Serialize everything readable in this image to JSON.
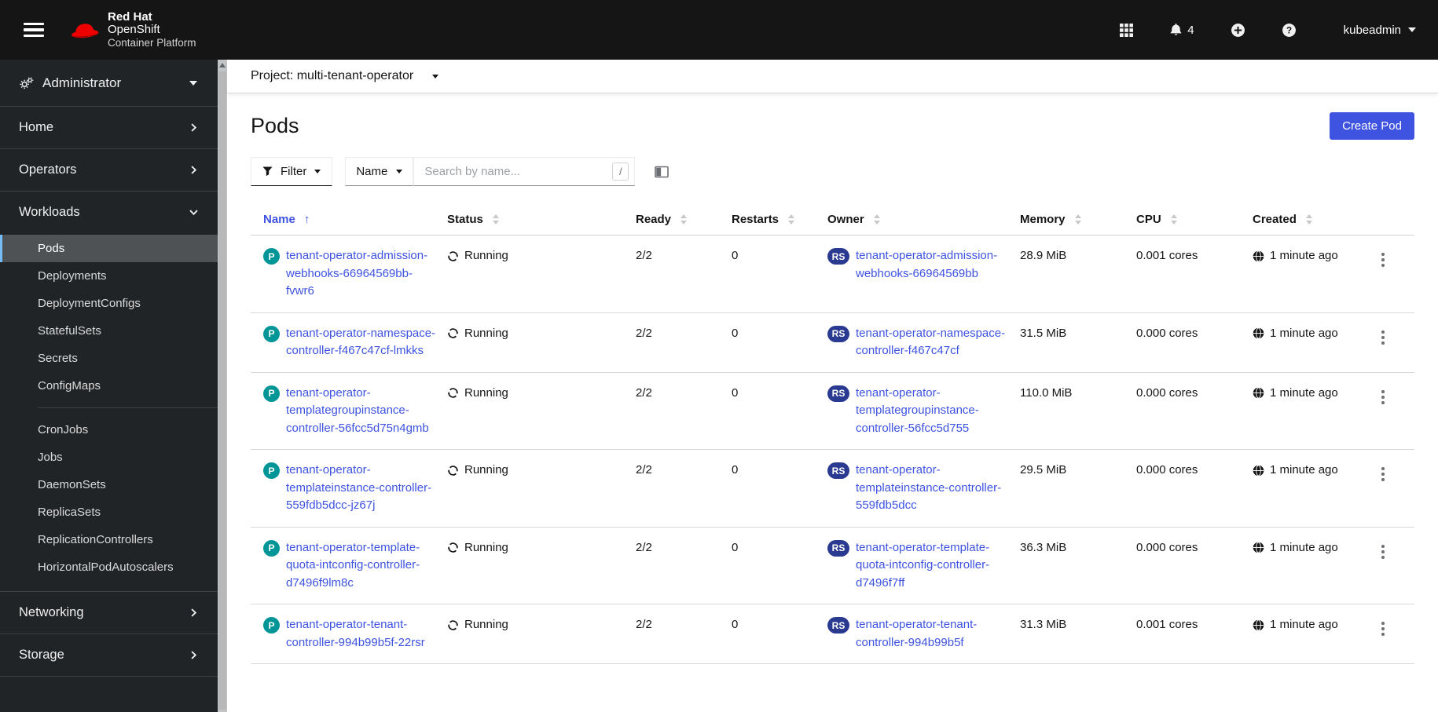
{
  "colors": {
    "accent": "#3e53e0",
    "masthead_bg": "#151515",
    "sidebar_bg": "#212427",
    "sidebar_divider": "#3c4043",
    "sidebar_active_bg": "#4f5255",
    "sidebar_active_bar": "#73bcf7",
    "badge_pod": "#009596",
    "badge_replicaset": "#2b3a91",
    "table_border": "#d8d8d8"
  },
  "masthead": {
    "brand_line1": "Red Hat",
    "brand_line2": "OpenShift",
    "brand_line3": "Container Platform",
    "notification_count": "4",
    "username": "kubeadmin"
  },
  "perspective_switcher": {
    "label": "Administrator"
  },
  "sidebar": {
    "sections": [
      {
        "label": "Home",
        "state": "collapsed"
      },
      {
        "label": "Operators",
        "state": "collapsed"
      },
      {
        "label": "Workloads",
        "state": "expanded",
        "items": [
          {
            "label": "Pods",
            "active": true
          },
          {
            "label": "Deployments"
          },
          {
            "label": "DeploymentConfigs"
          },
          {
            "label": "StatefulSets"
          },
          {
            "label": "Secrets"
          },
          {
            "label": "ConfigMaps"
          },
          {
            "divider": true
          },
          {
            "label": "CronJobs"
          },
          {
            "label": "Jobs"
          },
          {
            "label": "DaemonSets"
          },
          {
            "label": "ReplicaSets"
          },
          {
            "label": "ReplicationControllers"
          },
          {
            "label": "HorizontalPodAutoscalers"
          }
        ]
      },
      {
        "label": "Networking",
        "state": "collapsed"
      },
      {
        "label": "Storage",
        "state": "collapsed"
      }
    ]
  },
  "project_bar": {
    "label": "Project: multi-tenant-operator"
  },
  "page": {
    "title": "Pods",
    "create_button": "Create Pod"
  },
  "toolbar": {
    "filter_label": "Filter",
    "search_type": "Name",
    "search_placeholder": "Search by name...",
    "search_kbd": "/"
  },
  "table": {
    "columns": [
      {
        "label": "Name",
        "sorted": "asc"
      },
      {
        "label": "Status"
      },
      {
        "label": "Ready"
      },
      {
        "label": "Restarts"
      },
      {
        "label": "Owner"
      },
      {
        "label": "Memory"
      },
      {
        "label": "CPU"
      },
      {
        "label": "Created"
      }
    ],
    "rows": [
      {
        "badge": "P",
        "name": "tenant-operator-admission-webhooks-66964569bb-fvwr6",
        "status": "Running",
        "ready": "2/2",
        "restarts": "0",
        "owner_badge": "RS",
        "owner": "tenant-operator-admission-webhooks-66964569bb",
        "memory": "28.9 MiB",
        "cpu": "0.001 cores",
        "created": "1 minute ago"
      },
      {
        "badge": "P",
        "name": "tenant-operator-namespace-controller-f467c47cf-lmkks",
        "status": "Running",
        "ready": "2/2",
        "restarts": "0",
        "owner_badge": "RS",
        "owner": "tenant-operator-namespace-controller-f467c47cf",
        "memory": "31.5 MiB",
        "cpu": "0.000 cores",
        "created": "1 minute ago"
      },
      {
        "badge": "P",
        "name": "tenant-operator-templategroupinstance-controller-56fcc5d75n4gmb",
        "status": "Running",
        "ready": "2/2",
        "restarts": "0",
        "owner_badge": "RS",
        "owner": "tenant-operator-templategroupinstance-controller-56fcc5d755",
        "memory": "110.0 MiB",
        "cpu": "0.000 cores",
        "created": "1 minute ago"
      },
      {
        "badge": "P",
        "name": "tenant-operator-templateinstance-controller-559fdb5dcc-jz67j",
        "status": "Running",
        "ready": "2/2",
        "restarts": "0",
        "owner_badge": "RS",
        "owner": "tenant-operator-templateinstance-controller-559fdb5dcc",
        "memory": "29.5 MiB",
        "cpu": "0.000 cores",
        "created": "1 minute ago"
      },
      {
        "badge": "P",
        "name": "tenant-operator-template-quota-intconfig-controller-d7496f9lm8c",
        "status": "Running",
        "ready": "2/2",
        "restarts": "0",
        "owner_badge": "RS",
        "owner": "tenant-operator-template-quota-intconfig-controller-d7496f7ff",
        "memory": "36.3 MiB",
        "cpu": "0.000 cores",
        "created": "1 minute ago"
      },
      {
        "badge": "P",
        "name": "tenant-operator-tenant-controller-994b99b5f-22rsr",
        "status": "Running",
        "ready": "2/2",
        "restarts": "0",
        "owner_badge": "RS",
        "owner": "tenant-operator-tenant-controller-994b99b5f",
        "memory": "31.3 MiB",
        "cpu": "0.001 cores",
        "created": "1 minute ago"
      }
    ]
  }
}
